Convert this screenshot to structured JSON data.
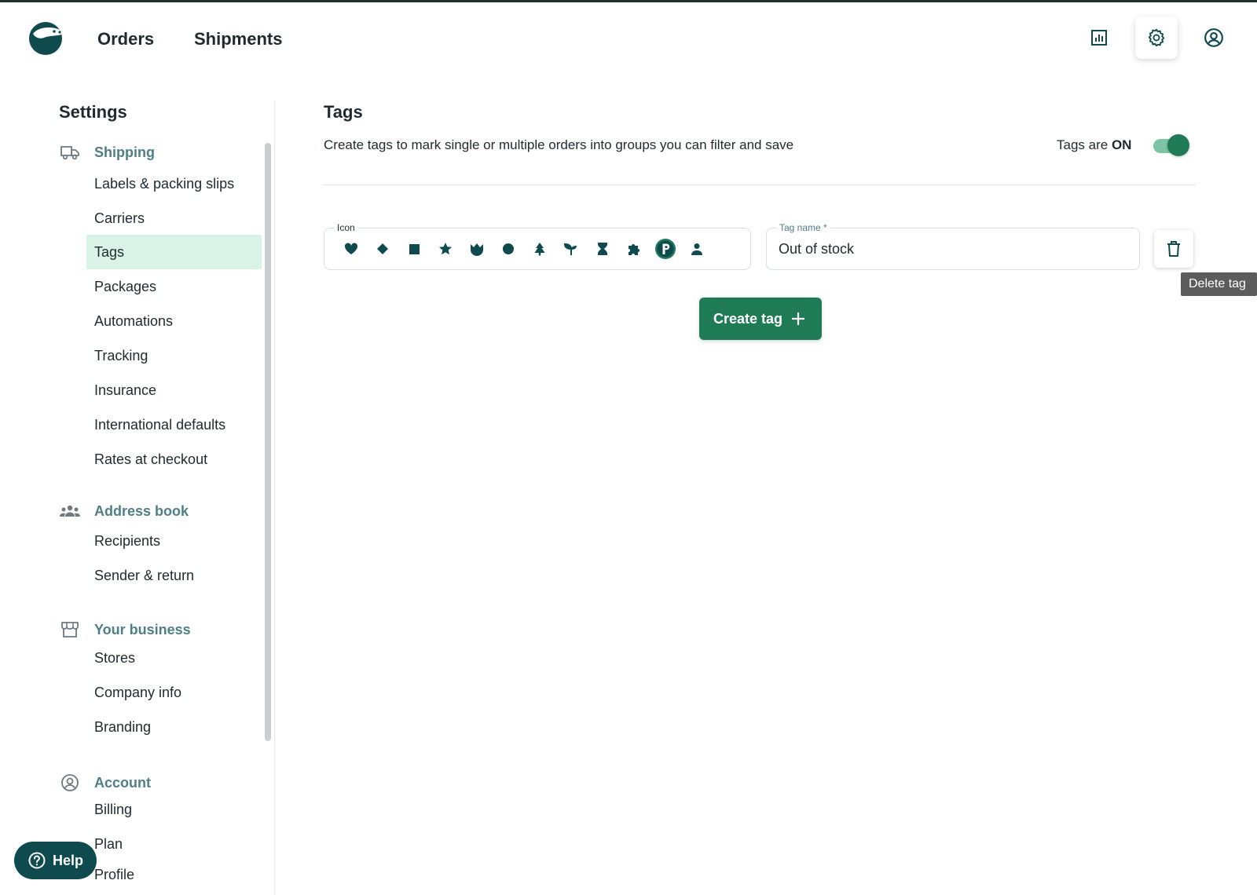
{
  "header": {
    "nav": [
      {
        "label": "Orders"
      },
      {
        "label": "Shipments"
      }
    ],
    "icons": [
      "reports-icon",
      "settings-gear-icon",
      "account-circle-icon"
    ]
  },
  "sidebar": {
    "title": "Settings",
    "sections": [
      {
        "label": "Shipping",
        "icon": "truck-icon",
        "items": [
          "Labels & packing slips",
          "Carriers",
          "Tags",
          "Packages",
          "Automations",
          "Tracking",
          "Insurance",
          "International defaults",
          "Rates at checkout"
        ]
      },
      {
        "label": "Address book",
        "icon": "people-group-icon",
        "items": [
          "Recipients",
          "Sender & return"
        ]
      },
      {
        "label": "Your business",
        "icon": "storefront-icon",
        "items": [
          "Stores",
          "Company info",
          "Branding"
        ]
      },
      {
        "label": "Account",
        "icon": "account-circle-icon",
        "items": [
          "Billing",
          "Plan",
          "Profile"
        ]
      }
    ],
    "active_item": "Tags"
  },
  "main": {
    "title": "Tags",
    "description": "Create tags to mark single or multiple orders into groups you can filter and save",
    "toggle": {
      "label_prefix": "Tags are",
      "label_state": "ON",
      "on": true
    },
    "tag": {
      "icon_legend": "Icon",
      "icons": [
        "heart",
        "diamond",
        "square",
        "star",
        "crown",
        "circle",
        "tree",
        "sprout",
        "hourglass",
        "puzzle",
        "p-badge",
        "person"
      ],
      "selected_icon": "p-badge",
      "name_legend": "Tag name *",
      "name_value": "Out of stock"
    },
    "delete_tooltip": "Delete tag",
    "create_button": "Create tag"
  },
  "help": {
    "label": "Help"
  },
  "colors": {
    "brand_dark": "#0e4a4e",
    "accent_green": "#1f7a56",
    "active_bg": "#d9f3e7",
    "section_label": "#4e7e86"
  }
}
